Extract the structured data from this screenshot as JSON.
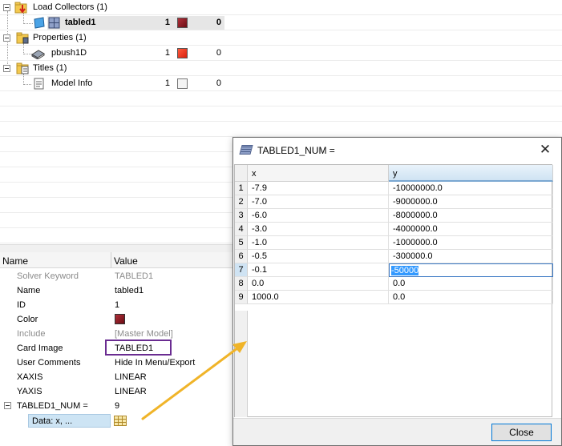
{
  "tree": {
    "load_collectors": {
      "label": "Load Collectors (1)"
    },
    "tabled1": {
      "label": "tabled1",
      "count": "1",
      "zero": "0",
      "color": "#8b1a1f"
    },
    "properties": {
      "label": "Properties (1)"
    },
    "pbush1d": {
      "label": "pbush1D",
      "count": "1",
      "zero": "0",
      "color": "#e8351f"
    },
    "titles": {
      "label": "Titles (1)"
    },
    "model_info": {
      "label": "Model Info",
      "count": "1",
      "zero": "0",
      "color": "#f4f4f4"
    }
  },
  "props": {
    "header_name": "Name",
    "header_value": "Value",
    "rows": [
      {
        "name": "Solver Keyword",
        "value": "TABLED1"
      },
      {
        "name": "Name",
        "value": "tabled1"
      },
      {
        "name": "ID",
        "value": "1"
      },
      {
        "name": "Color",
        "value": ""
      },
      {
        "name": "Include",
        "value": "[Master Model]"
      },
      {
        "name": "Card Image",
        "value": "TABLED1"
      },
      {
        "name": "User Comments",
        "value": "Hide In Menu/Export"
      },
      {
        "name": "XAXIS",
        "value": "LINEAR"
      },
      {
        "name": "YAXIS",
        "value": "LINEAR"
      },
      {
        "name": "TABLED1_NUM =",
        "value": "9"
      }
    ],
    "data_cell": "Data: x, ...",
    "color_value": "#8b1a1f",
    "card_highlight_color": "#6a2c91"
  },
  "dialog": {
    "title": "TABLED1_NUM =",
    "close_x": "✕",
    "columns": [
      "x",
      "y"
    ],
    "rows": [
      {
        "n": "1",
        "x": "-7.9",
        "y": "-10000000.0"
      },
      {
        "n": "2",
        "x": "-7.0",
        "y": "-9000000.0"
      },
      {
        "n": "3",
        "x": "-6.0",
        "y": "-8000000.0"
      },
      {
        "n": "4",
        "x": "-3.0",
        "y": "-4000000.0"
      },
      {
        "n": "5",
        "x": "-1.0",
        "y": "-1000000.0"
      },
      {
        "n": "6",
        "x": "-0.5",
        "y": "-300000.0"
      },
      {
        "n": "7",
        "x": "-0.1",
        "y": "-50000"
      },
      {
        "n": "8",
        "x": "0.0",
        "y": "0.0"
      },
      {
        "n": "9",
        "x": "1000.0",
        "y": "0.0"
      }
    ],
    "close_button": "Close"
  },
  "annotation": {
    "arrow_color": "#f0b429",
    "arrow_icon": "arrow-annotation"
  }
}
